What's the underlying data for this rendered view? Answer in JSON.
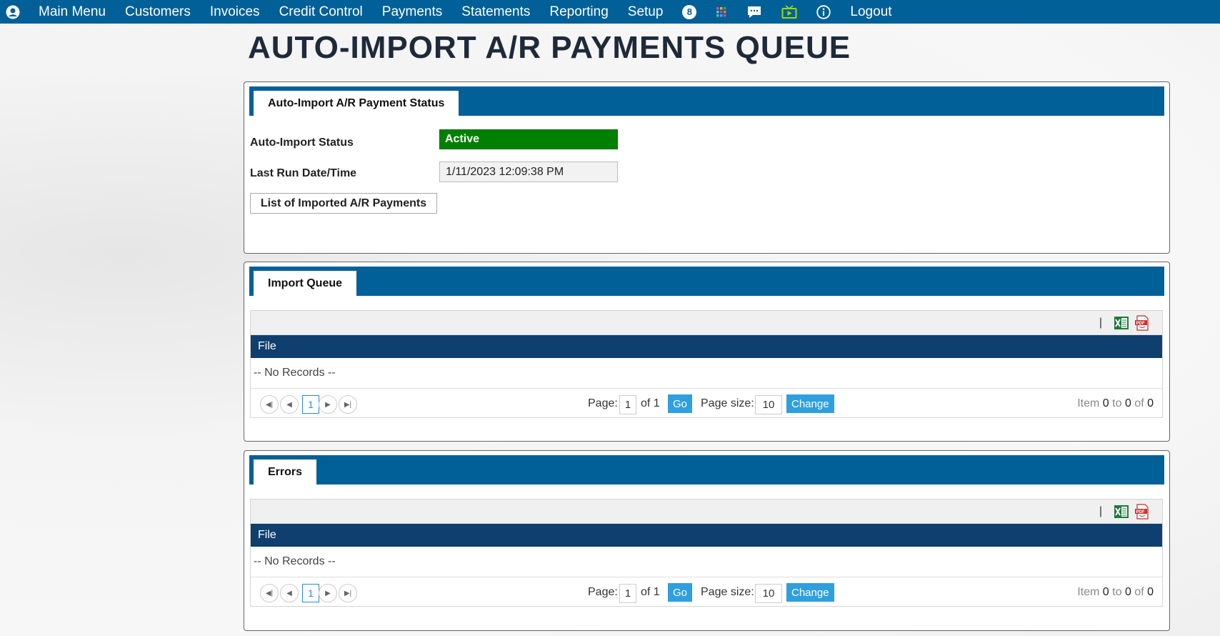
{
  "nav": {
    "items": [
      "Main Menu",
      "Customers",
      "Invoices",
      "Credit Control",
      "Payments",
      "Statements",
      "Reporting",
      "Setup"
    ],
    "badge_count": "8",
    "logout": "Logout",
    "icons": [
      "user-icon",
      "apps-grid-icon",
      "chat-icon",
      "tv-icon",
      "info-icon"
    ]
  },
  "page": {
    "title": "AUTO-IMPORT A/R PAYMENTS QUEUE"
  },
  "status_panel": {
    "tab": "Auto-Import A/R Payment Status",
    "status_label": "Auto-Import Status",
    "status_value": "Active",
    "last_run_label": "Last Run Date/Time",
    "last_run_value": "1/11/2023 12:09:38 PM",
    "list_button": "List of Imported A/R Payments"
  },
  "queue_panel": {
    "tab": "Import Queue",
    "column": "File",
    "empty": "-- No Records --",
    "pager": {
      "current_page": "1",
      "page_label": "Page:",
      "page_input": "1",
      "of_label": "of 1",
      "go": "Go",
      "page_size_label": "Page size:",
      "page_size": "10",
      "change": "Change",
      "item_label": "Item",
      "from": "0",
      "to_label": "to",
      "to": "0",
      "of_word": "of",
      "total": "0"
    }
  },
  "errors_panel": {
    "tab": "Errors",
    "column": "File",
    "empty": "-- No Records --",
    "pager": {
      "current_page": "1",
      "page_label": "Page:",
      "page_input": "1",
      "of_label": "of 1",
      "go": "Go",
      "page_size_label": "Page size:",
      "page_size": "10",
      "change": "Change",
      "item_label": "Item",
      "from": "0",
      "to_label": "to",
      "to": "0",
      "of_word": "of",
      "total": "0"
    }
  },
  "colors": {
    "nav_bg": "#006097",
    "grid_header": "#0e3f6f",
    "status_active": "#008000",
    "button_blue": "#2f9fe0"
  }
}
